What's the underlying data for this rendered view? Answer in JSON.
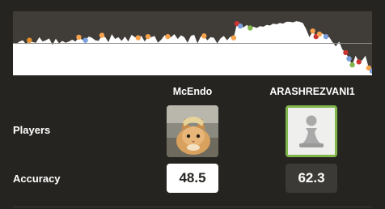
{
  "players": {
    "white": {
      "name": "McEndo",
      "accuracy": "48.5"
    },
    "black": {
      "name": "ARASHREZVANI1",
      "accuracy": "62.3"
    }
  },
  "labels": {
    "players": "Players",
    "accuracy": "Accuracy"
  },
  "colors": {
    "background": "#262421",
    "graph_top": "#403d39",
    "graph_fill": "#ffffff",
    "marker_inaccuracy": "#f7a24c",
    "marker_mistake": "#e58f2a",
    "marker_blunder": "#ca3431",
    "marker_good": "#7a9fdc",
    "marker_best": "#81b64c",
    "avatar_border_active": "#80b64b"
  },
  "chart_data": {
    "type": "area",
    "title": "",
    "xlabel": "",
    "ylabel": "",
    "ylim": [
      -1,
      1
    ],
    "x_count": 110,
    "evals": [
      0.0,
      -0.02,
      0.06,
      0.1,
      -0.03,
      0.1,
      0.04,
      0.02,
      0.2,
      0.06,
      0.1,
      0.16,
      -0.05,
      0.15,
      0.0,
      0.08,
      0.02,
      0.06,
      0.12,
      0.06,
      0.2,
      0.12,
      0.1,
      0.22,
      0.18,
      0.1,
      0.08,
      0.26,
      0.2,
      0.04,
      0.3,
      0.14,
      0.2,
      0.08,
      0.22,
      0.06,
      0.28,
      0.2,
      0.18,
      0.24,
      0.06,
      0.22,
      0.2,
      0.24,
      0.02,
      0.12,
      0.26,
      0.22,
      0.2,
      0.3,
      0.14,
      0.26,
      0.2,
      0.02,
      0.24,
      0.28,
      0.0,
      0.22,
      0.24,
      0.1,
      0.2,
      0.18,
      0.0,
      0.16,
      0.24,
      0.1,
      0.22,
      0.18,
      0.64,
      0.56,
      0.52,
      0.6,
      0.5,
      0.54,
      0.5,
      0.56,
      0.54,
      0.6,
      0.58,
      0.64,
      0.62,
      0.66,
      0.64,
      0.7,
      0.7,
      0.68,
      0.72,
      0.7,
      0.66,
      0.46,
      0.2,
      0.4,
      0.22,
      0.3,
      0.32,
      0.22,
      0.2,
      0.04,
      -0.1,
      0.06,
      -0.2,
      -0.3,
      -0.5,
      -0.7,
      -0.4,
      -0.6,
      -0.55,
      -0.4,
      -0.8,
      -0.9
    ],
    "markers": [
      {
        "x": 5,
        "kind": "mistake"
      },
      {
        "x": 20,
        "kind": "inaccuracy"
      },
      {
        "x": 22,
        "kind": "good"
      },
      {
        "x": 27,
        "kind": "inaccuracy"
      },
      {
        "x": 38,
        "kind": "inaccuracy"
      },
      {
        "x": 41,
        "kind": "inaccuracy"
      },
      {
        "x": 47,
        "kind": "inaccuracy"
      },
      {
        "x": 58,
        "kind": "inaccuracy"
      },
      {
        "x": 67,
        "kind": "inaccuracy"
      },
      {
        "x": 68,
        "kind": "blunder"
      },
      {
        "x": 69,
        "kind": "good"
      },
      {
        "x": 72,
        "kind": "best"
      },
      {
        "x": 91,
        "kind": "inaccuracy"
      },
      {
        "x": 92,
        "kind": "blunder"
      },
      {
        "x": 93,
        "kind": "inaccuracy"
      },
      {
        "x": 95,
        "kind": "good"
      },
      {
        "x": 101,
        "kind": "blunder"
      },
      {
        "x": 102,
        "kind": "good"
      },
      {
        "x": 103,
        "kind": "best"
      },
      {
        "x": 105,
        "kind": "blunder"
      },
      {
        "x": 108,
        "kind": "inaccuracy"
      },
      {
        "x": 109,
        "kind": "good"
      }
    ]
  }
}
